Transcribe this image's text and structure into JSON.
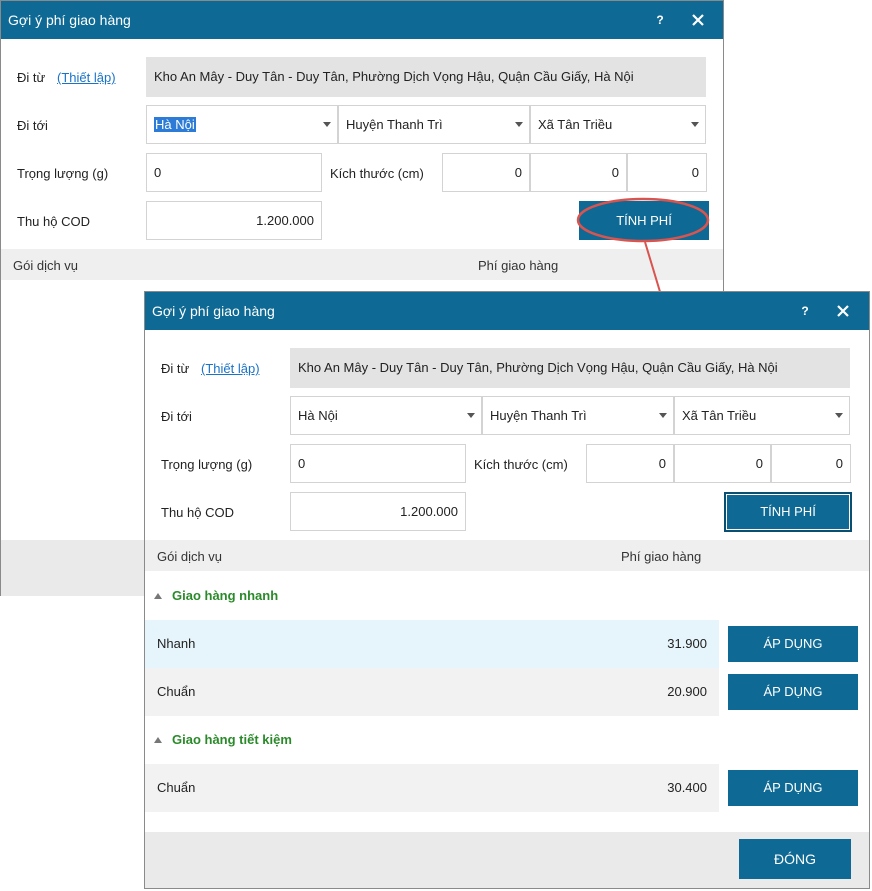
{
  "dialog": {
    "title": "Gợi ý phí giao hàng",
    "help_label": "?",
    "from_label": "Đi từ",
    "setup_link": "(Thiết lập)",
    "from_address": "Kho An Mây - Duy Tân - Duy Tân, Phường Dịch Vọng Hậu, Quận Cầu Giấy, Hà Nội",
    "to_label": "Đi tới",
    "province": "Hà Nội",
    "district": "Huyện Thanh Trì",
    "ward": "Xã Tân Triều",
    "weight_label": "Trọng lượng (g)",
    "weight_value": "0",
    "size_label": "Kích thước (cm)",
    "size_values": [
      "0",
      "0",
      "0"
    ],
    "cod_label": "Thu hộ COD",
    "cod_value": "1.200.000",
    "calc_button": "TÍNH PHÍ",
    "col_service": "Gói dịch vụ",
    "col_fee": "Phí giao hàng"
  },
  "results": {
    "groups": [
      {
        "name": "Giao hàng nhanh",
        "services": [
          {
            "name": "Nhanh",
            "fee": "31.900",
            "action": "ÁP DỤNG"
          },
          {
            "name": "Chuẩn",
            "fee": "20.900",
            "action": "ÁP DỤNG"
          }
        ]
      },
      {
        "name": "Giao hàng tiết kiệm",
        "services": [
          {
            "name": "Chuẩn",
            "fee": "30.400",
            "action": "ÁP DỤNG"
          }
        ]
      }
    ],
    "close_button": "ĐÓNG"
  },
  "colors": {
    "titlebar": "#0e6a94",
    "group_text": "#2a8a2a",
    "annotation": "#d9534f",
    "row_highlight": "#e6f4fb"
  }
}
